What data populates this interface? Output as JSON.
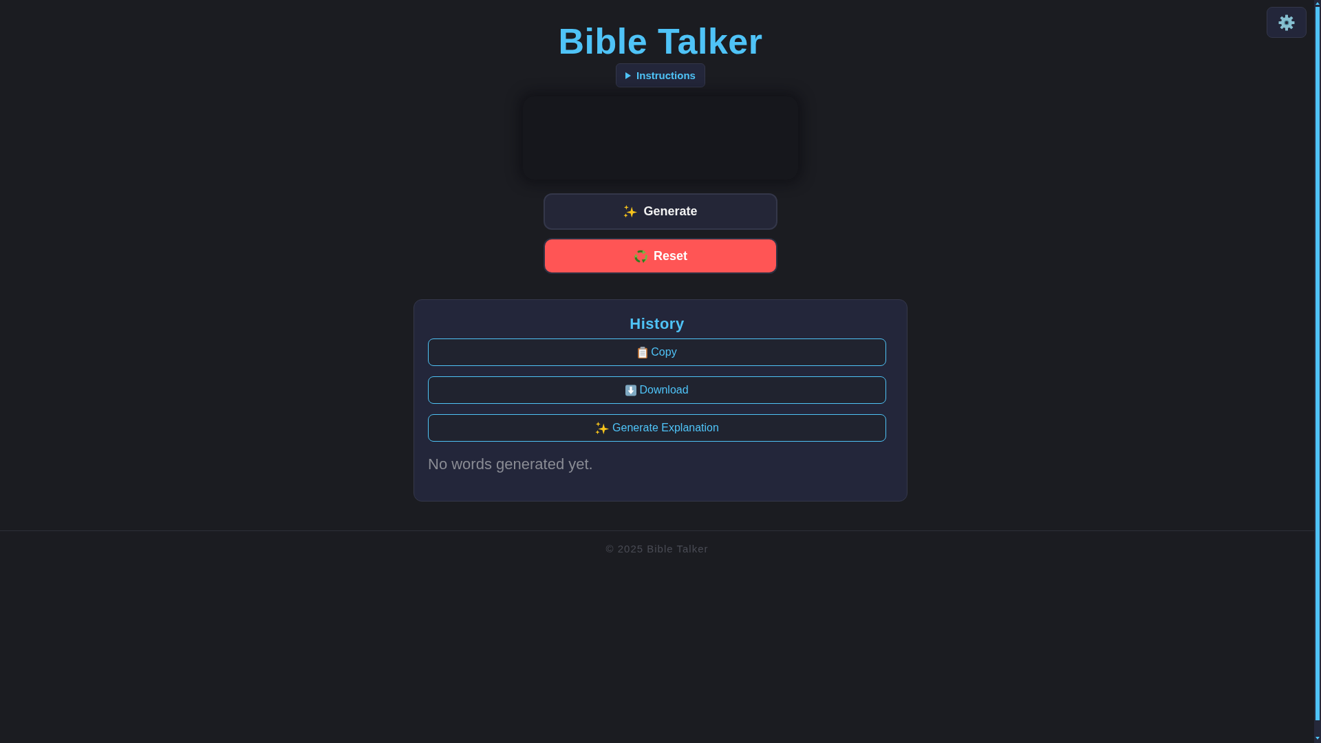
{
  "header": {
    "title": "Bible Talker",
    "instructions": {
      "label": "Instructions",
      "expanded": false
    }
  },
  "actions": [
    {
      "kind": "generate",
      "label": "Generate"
    },
    {
      "kind": "reset",
      "label": "Reset"
    }
  ],
  "history": {
    "title": "History",
    "buttons": [
      {
        "kind": "copy",
        "label": "Copy"
      },
      {
        "kind": "download",
        "label": "Download"
      },
      {
        "kind": "explain",
        "label": "Generate Explanation"
      }
    ],
    "empty_message": "No words generated yet."
  },
  "footer": {
    "text": "© 2025 Bible Talker"
  }
}
